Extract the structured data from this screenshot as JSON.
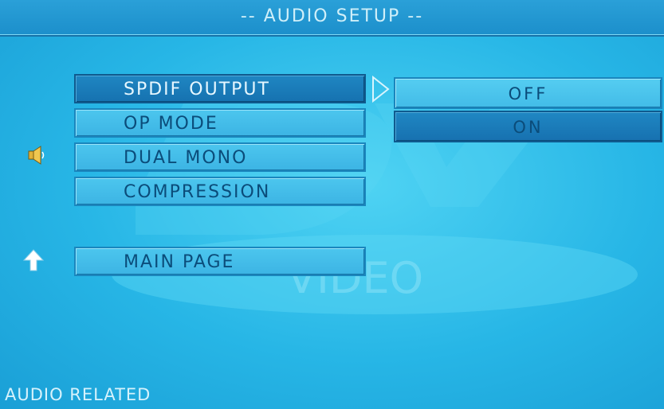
{
  "header": {
    "title": "-- AUDIO SETUP --"
  },
  "watermark": {
    "text": "VIDEO"
  },
  "menu": {
    "items": [
      {
        "label": "SPDIF OUTPUT"
      },
      {
        "label": "OP MODE"
      },
      {
        "label": "DUAL MONO"
      },
      {
        "label": "COMPRESSION"
      }
    ],
    "main_page_label": "MAIN PAGE"
  },
  "options": {
    "items": [
      {
        "label": "OFF"
      },
      {
        "label": "ON"
      }
    ]
  },
  "icons": {
    "speaker": "speaker-icon",
    "up_arrow": "up-arrow-icon",
    "submenu_arrow": "chevron-right-icon"
  },
  "status": {
    "text": "AUDIO RELATED"
  },
  "colors": {
    "background": "#27b6e6",
    "selected": "#1f86c2",
    "text_dark": "#0b4c7a",
    "text_light": "#e6f7ff"
  }
}
